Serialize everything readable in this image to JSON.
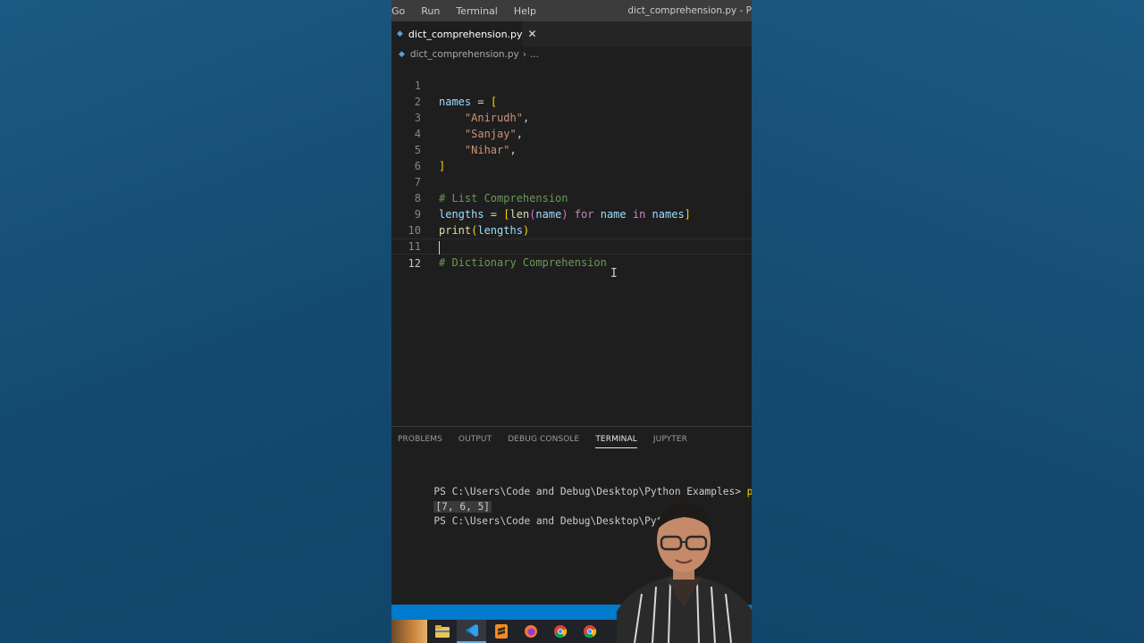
{
  "menubar": {
    "items": [
      "Go",
      "Run",
      "Terminal",
      "Help"
    ],
    "window_title": "dict_comprehension.py - P"
  },
  "tab": {
    "label": "dict_comprehension.py",
    "close": "✕"
  },
  "breadcrumb": {
    "file": "dict_comprehension.py",
    "sep": "›",
    "rest": "..."
  },
  "editor": {
    "line_numbers": [
      "1",
      "2",
      "3",
      "4",
      "5",
      "6",
      "7",
      "8",
      "9",
      "10",
      "11",
      "12"
    ],
    "current_line": 12,
    "lines": [
      "names = [",
      "    \"Anirudh\",",
      "    \"Sanjay\",",
      "    \"Nihar\",",
      "]",
      "",
      "# List Comprehension",
      "lengths = [len(name) for name in names]",
      "print(lengths)",
      "",
      "# Dictionary Comprehension",
      ""
    ]
  },
  "panel": {
    "tabs": [
      "PROBLEMS",
      "OUTPUT",
      "DEBUG CONSOLE",
      "TERMINAL",
      "JUPYTER"
    ],
    "active_tab": "TERMINAL"
  },
  "terminal": {
    "prompt1": "PS C:\\Users\\Code and Debug\\Desktop\\Python Examples> ",
    "command1": "python",
    "output": "[7, 6, 5]",
    "prompt2": "PS C:\\Users\\Code and Debug\\Desktop\\Python Exa"
  },
  "taskbar": {
    "icons": [
      "file-explorer-icon",
      "vscode-icon",
      "sublime-icon",
      "firefox-icon",
      "chrome-icon",
      "chrome-alt-icon"
    ]
  },
  "colors": {
    "accent": "#007acc",
    "background": "#154a6f",
    "editor_bg": "#1e1e1e"
  }
}
